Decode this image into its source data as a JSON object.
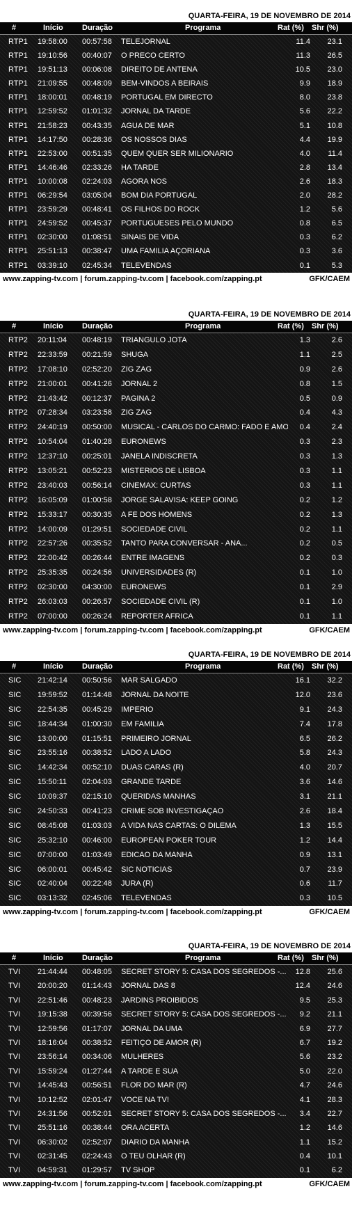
{
  "header": {
    "num": "#",
    "inicio": "Início",
    "duracao": "Duração",
    "programa": "Programa",
    "rat": "Rat (%)",
    "shr": "Shr (%)"
  },
  "footer": {
    "links": "www.zapping-tv.com | forum.zapping-tv.com | facebook.com/zapping.pt",
    "source": "GFK/CAEM"
  },
  "sections": [
    {
      "date": "QUARTA-FEIRA, 19 DE NOVEMBRO DE 2014",
      "rows": [
        [
          "RTP1",
          "19:58:00",
          "00:57:58",
          "TELEJORNAL",
          "11.4",
          "23.1"
        ],
        [
          "RTP1",
          "19:10:56",
          "00:40:07",
          "O PRECO CERTO",
          "11.3",
          "26.5"
        ],
        [
          "RTP1",
          "19:51:13",
          "00:06:08",
          "DIREITO DE ANTENA",
          "10.5",
          "23.0"
        ],
        [
          "RTP1",
          "21:09:55",
          "00:48:09",
          "BEM-VINDOS A BEIRAIS",
          "9.9",
          "18.9"
        ],
        [
          "RTP1",
          "18:00:01",
          "00:48:19",
          "PORTUGAL EM DIRECTO",
          "8.0",
          "23.8"
        ],
        [
          "RTP1",
          "12:59:52",
          "01:01:32",
          "JORNAL DA TARDE",
          "5.6",
          "22.2"
        ],
        [
          "RTP1",
          "21:58:23",
          "00:43:35",
          "AGUA DE MAR",
          "5.1",
          "10.8"
        ],
        [
          "RTP1",
          "14:17:50",
          "00:28:36",
          "OS NOSSOS DIAS",
          "4.4",
          "19.9"
        ],
        [
          "RTP1",
          "22:53:00",
          "00:51:35",
          "QUEM QUER SER MILIONARIO",
          "4.0",
          "11.4"
        ],
        [
          "RTP1",
          "14:46:46",
          "02:33:26",
          "HA TARDE",
          "2.8",
          "13.4"
        ],
        [
          "RTP1",
          "10:00:08",
          "02:24:03",
          "AGORA NOS",
          "2.6",
          "18.3"
        ],
        [
          "RTP1",
          "06:29:54",
          "03:05:04",
          "BOM DIA PORTUGAL",
          "2.0",
          "28.2"
        ],
        [
          "RTP1",
          "23:59:29",
          "00:48:41",
          "OS FILHOS DO ROCK",
          "1.2",
          "5.6"
        ],
        [
          "RTP1",
          "24:59:52",
          "00:45:37",
          "PORTUGUESES PELO MUNDO",
          "0.8",
          "6.5"
        ],
        [
          "RTP1",
          "02:30:00",
          "01:08:51",
          "SINAIS DE VIDA",
          "0.3",
          "6.2"
        ],
        [
          "RTP1",
          "25:51:13",
          "00:38:47",
          "UMA FAMILIA AÇORIANA",
          "0.3",
          "3.6"
        ],
        [
          "RTP1",
          "03:39:10",
          "02:45:34",
          "TELEVENDAS",
          "0.1",
          "5.3"
        ]
      ]
    },
    {
      "date": "QUARTA-FEIRA, 19 DE NOVEMBRO DE 2014",
      "rows": [
        [
          "RTP2",
          "20:11:04",
          "00:48:19",
          "TRIANGULO JOTA",
          "1.3",
          "2.6"
        ],
        [
          "RTP2",
          "22:33:59",
          "00:21:59",
          "SHUGA",
          "1.1",
          "2.5"
        ],
        [
          "RTP2",
          "17:08:10",
          "02:52:20",
          "ZIG ZAG",
          "0.9",
          "2.6"
        ],
        [
          "RTP2",
          "21:00:01",
          "00:41:26",
          "JORNAL 2",
          "0.8",
          "1.5"
        ],
        [
          "RTP2",
          "21:43:42",
          "00:12:37",
          "PAGINA 2",
          "0.5",
          "0.9"
        ],
        [
          "RTP2",
          "07:28:34",
          "03:23:58",
          "ZIG ZAG",
          "0.4",
          "4.3"
        ],
        [
          "RTP2",
          "24:40:19",
          "00:50:00",
          "MUSICAL - CARLOS DO CARMO: FADO E AMOR",
          "0.4",
          "2.4"
        ],
        [
          "RTP2",
          "10:54:04",
          "01:40:28",
          "EURONEWS",
          "0.3",
          "2.3"
        ],
        [
          "RTP2",
          "12:37:10",
          "00:25:01",
          "JANELA INDISCRETA",
          "0.3",
          "1.3"
        ],
        [
          "RTP2",
          "13:05:21",
          "00:52:23",
          "MISTERIOS DE LISBOA",
          "0.3",
          "1.1"
        ],
        [
          "RTP2",
          "23:40:03",
          "00:56:14",
          "CINEMAX: CURTAS",
          "0.3",
          "1.1"
        ],
        [
          "RTP2",
          "16:05:09",
          "01:00:58",
          "JORGE SALAVISA: KEEP GOING",
          "0.2",
          "1.2"
        ],
        [
          "RTP2",
          "15:33:17",
          "00:30:35",
          "A FE DOS HOMENS",
          "0.2",
          "1.3"
        ],
        [
          "RTP2",
          "14:00:09",
          "01:29:51",
          "SOCIEDADE CIVIL",
          "0.2",
          "1.1"
        ],
        [
          "RTP2",
          "22:57:26",
          "00:35:52",
          "TANTO PARA CONVERSAR - ANA...",
          "0.2",
          "0.5"
        ],
        [
          "RTP2",
          "22:00:42",
          "00:26:44",
          "ENTRE IMAGENS",
          "0.2",
          "0.3"
        ],
        [
          "RTP2",
          "25:35:35",
          "00:24:56",
          "UNIVERSIDADES (R)",
          "0.1",
          "1.0"
        ],
        [
          "RTP2",
          "02:30:00",
          "04:30:00",
          "EURONEWS",
          "0.1",
          "2.9"
        ],
        [
          "RTP2",
          "26:03:03",
          "00:26:57",
          "SOCIEDADE CIVIL (R)",
          "0.1",
          "1.0"
        ],
        [
          "RTP2",
          "07:00:00",
          "00:26:24",
          "REPORTER AFRICA",
          "0.1",
          "1.1"
        ]
      ]
    },
    {
      "date": "QUARTA-FEIRA, 19 DE NOVEMBRO DE 2014",
      "rows": [
        [
          "SIC",
          "21:42:14",
          "00:50:56",
          "MAR SALGADO",
          "16.1",
          "32.2"
        ],
        [
          "SIC",
          "19:59:52",
          "01:14:48",
          "JORNAL DA NOITE",
          "12.0",
          "23.6"
        ],
        [
          "SIC",
          "22:54:35",
          "00:45:29",
          "IMPERIO",
          "9.1",
          "24.3"
        ],
        [
          "SIC",
          "18:44:34",
          "01:00:30",
          "EM FAMILIA",
          "7.4",
          "17.8"
        ],
        [
          "SIC",
          "13:00:00",
          "01:15:51",
          "PRIMEIRO JORNAL",
          "6.5",
          "26.2"
        ],
        [
          "SIC",
          "23:55:16",
          "00:38:52",
          "LADO A LADO",
          "5.8",
          "24.3"
        ],
        [
          "SIC",
          "14:42:34",
          "00:52:10",
          "DUAS CARAS (R)",
          "4.0",
          "20.7"
        ],
        [
          "SIC",
          "15:50:11",
          "02:04:03",
          "GRANDE TARDE",
          "3.6",
          "14.6"
        ],
        [
          "SIC",
          "10:09:37",
          "02:15:10",
          "QUERIDAS MANHAS",
          "3.1",
          "21.1"
        ],
        [
          "SIC",
          "24:50:33",
          "00:41:23",
          "CRIME SOB INVESTIGAÇAO",
          "2.6",
          "18.4"
        ],
        [
          "SIC",
          "08:45:08",
          "01:03:03",
          "A VIDA NAS CARTAS: O DILEMA",
          "1.3",
          "15.5"
        ],
        [
          "SIC",
          "25:32:10",
          "00:46:00",
          "EUROPEAN POKER TOUR",
          "1.2",
          "14.4"
        ],
        [
          "SIC",
          "07:00:00",
          "01:03:49",
          "EDICAO DA MANHA",
          "0.9",
          "13.1"
        ],
        [
          "SIC",
          "06:00:01",
          "00:45:42",
          "SIC NOTICIAS",
          "0.7",
          "23.9"
        ],
        [
          "SIC",
          "02:40:04",
          "00:22:48",
          "JURA (R)",
          "0.6",
          "11.7"
        ],
        [
          "SIC",
          "03:13:32",
          "02:45:06",
          "TELEVENDAS",
          "0.3",
          "10.5"
        ]
      ]
    },
    {
      "date": "QUARTA-FEIRA, 19 DE NOVEMBRO DE 2014",
      "rows": [
        [
          "TVI",
          "21:44:44",
          "00:48:05",
          "SECRET STORY 5: CASA DOS SEGREDOS -...",
          "12.8",
          "25.6"
        ],
        [
          "TVI",
          "20:00:20",
          "01:14:43",
          "JORNAL DAS 8",
          "12.4",
          "24.6"
        ],
        [
          "TVI",
          "22:51:46",
          "00:48:23",
          "JARDINS PROIBIDOS",
          "9.5",
          "25.3"
        ],
        [
          "TVI",
          "19:15:38",
          "00:39:56",
          "SECRET STORY 5: CASA DOS SEGREDOS -...",
          "9.2",
          "21.1"
        ],
        [
          "TVI",
          "12:59:56",
          "01:17:07",
          "JORNAL DA UMA",
          "6.9",
          "27.7"
        ],
        [
          "TVI",
          "18:16:04",
          "00:38:52",
          "FEITIÇO DE AMOR (R)",
          "6.7",
          "19.2"
        ],
        [
          "TVI",
          "23:56:14",
          "00:34:06",
          "MULHERES",
          "5.6",
          "23.2"
        ],
        [
          "TVI",
          "15:59:24",
          "01:27:44",
          "A TARDE E SUA",
          "5.0",
          "22.0"
        ],
        [
          "TVI",
          "14:45:43",
          "00:56:51",
          "FLOR DO MAR (R)",
          "4.7",
          "24.6"
        ],
        [
          "TVI",
          "10:12:52",
          "02:01:47",
          "VOCE NA TV!",
          "4.1",
          "28.3"
        ],
        [
          "TVI",
          "24:31:56",
          "00:52:01",
          "SECRET STORY 5: CASA DOS SEGREDOS -...",
          "3.4",
          "22.7"
        ],
        [
          "TVI",
          "25:51:16",
          "00:38:44",
          "ORA ACERTA",
          "1.2",
          "14.6"
        ],
        [
          "TVI",
          "06:30:02",
          "02:52:07",
          "DIARIO DA MANHA",
          "1.1",
          "15.2"
        ],
        [
          "TVI",
          "02:31:45",
          "02:24:43",
          "O TEU OLHAR (R)",
          "0.4",
          "10.1"
        ],
        [
          "TVI",
          "04:59:31",
          "01:29:57",
          "TV SHOP",
          "0.1",
          "6.2"
        ]
      ]
    }
  ]
}
